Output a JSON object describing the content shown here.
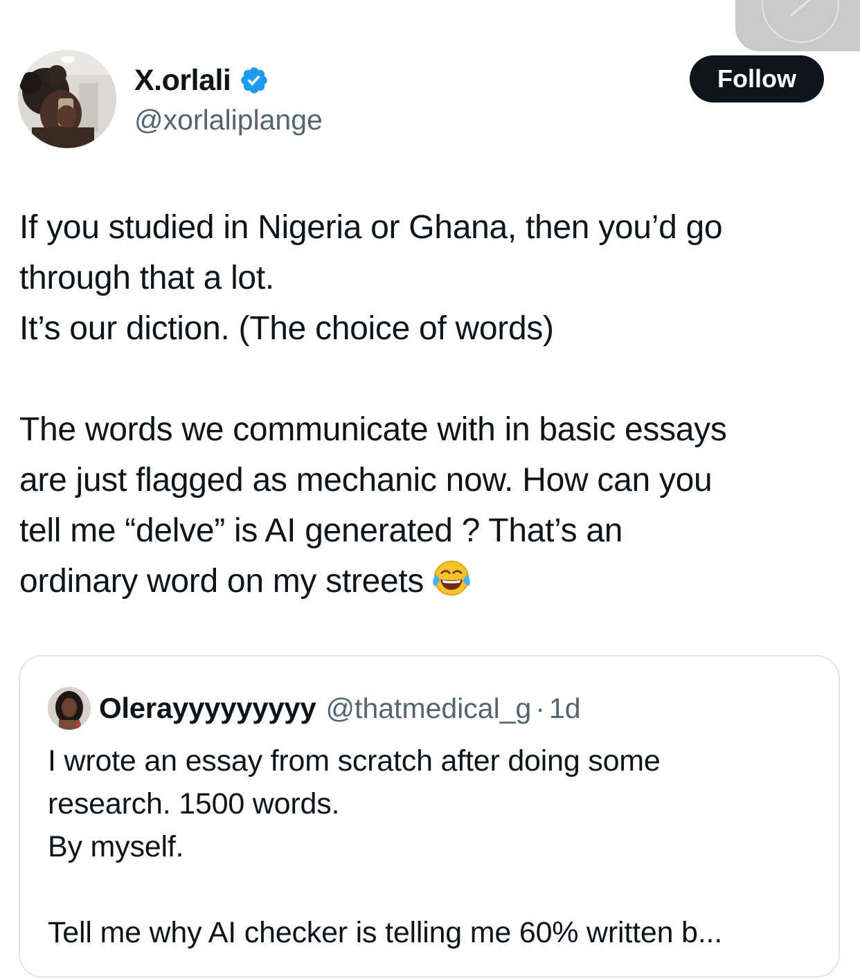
{
  "author": {
    "display_name": "X.orlali",
    "handle": "@xorlaliplange",
    "verified": true,
    "verified_icon": "verified-badge-icon",
    "verified_color": "#1d9bf0"
  },
  "follow_button": {
    "label": "Follow"
  },
  "tweet": {
    "lines": [
      "If you studied in Nigeria or Ghana, then you’d go",
      "through that a lot.",
      "It’s our diction. (The choice of words)",
      "",
      "The words we communicate with in basic essays",
      "are just flagged as mechanic now. How can you",
      "tell me “delve” is AI generated ? That’s an",
      "ordinary word on my streets"
    ],
    "trailing_emoji": "face-with-tears-of-joy-emoji"
  },
  "quoted_tweet": {
    "display_name": "Olerayyyyyyyyy",
    "handle": "@thatmedical_g",
    "separator": "·",
    "timestamp": "1d",
    "lines": [
      "I wrote an essay from scratch after doing some",
      "research. 1500 words.",
      "By myself.",
      "",
      "Tell me why AI checker is telling me 60% written b..."
    ]
  },
  "colors": {
    "text_primary": "#0f1419",
    "text_secondary": "#536471",
    "follow_bg": "#0f1419",
    "follow_text": "#ffffff",
    "card_border": "#e1e5e8",
    "accent_blue": "#1d9bf0"
  }
}
